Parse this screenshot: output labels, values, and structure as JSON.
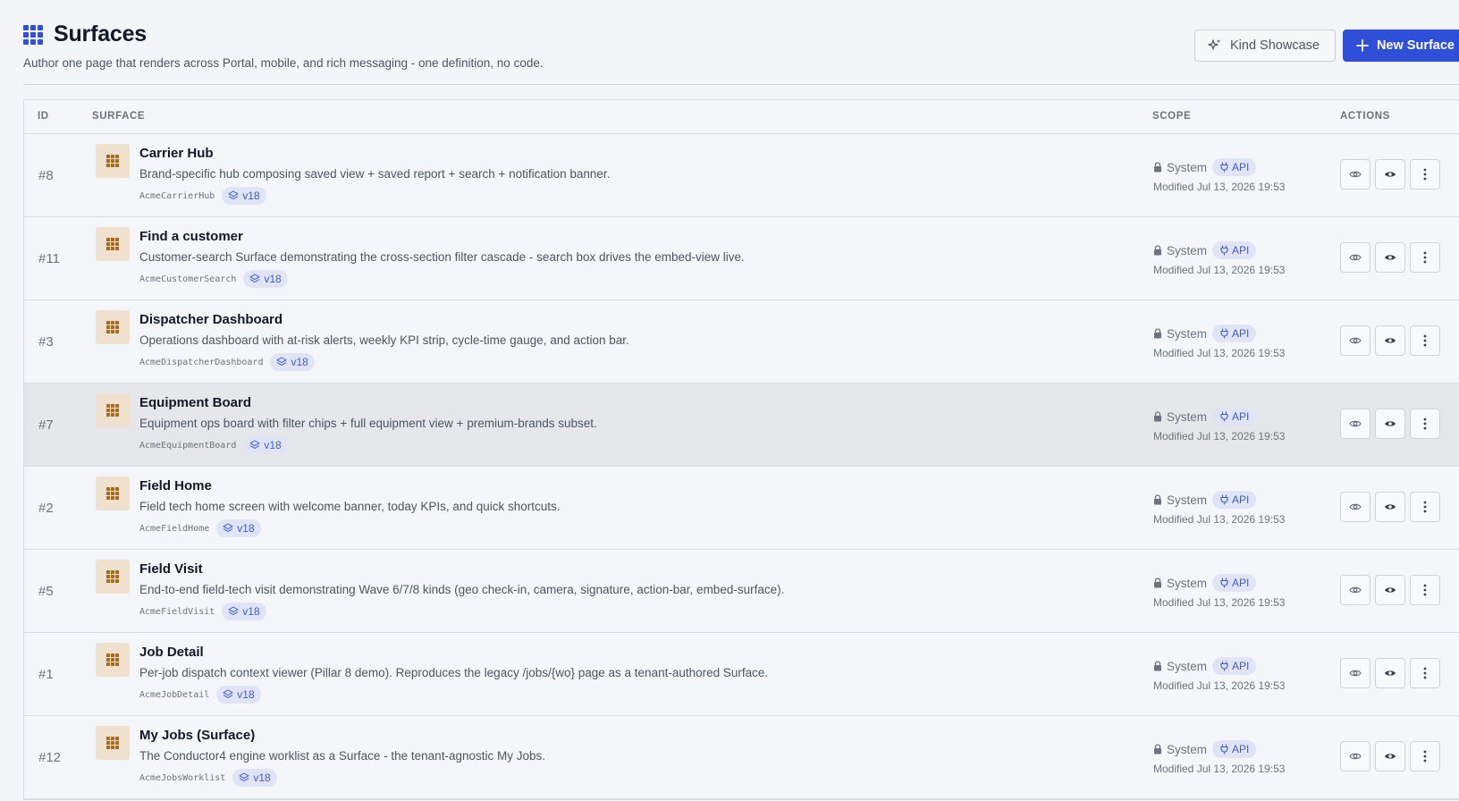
{
  "header": {
    "title": "Surfaces",
    "subtitle": "Author one page that renders across Portal, mobile, and rich messaging - one definition, no code.",
    "kind_showcase_label": "Kind Showcase",
    "new_surface_label": "New Surface"
  },
  "colors": {
    "primary": "#2f4fd8",
    "thumb_bg": "#f0e1cf",
    "thumb_icon": "#a86a1f",
    "badge_bg": "#dfe4f7",
    "badge_text": "#3f5bd3"
  },
  "table": {
    "columns": {
      "id": "ID",
      "surface": "SURFACE",
      "scope": "SCOPE",
      "actions": "ACTIONS"
    },
    "rows": [
      {
        "id": "#8",
        "name": "Carrier Hub",
        "description": "Brand-specific hub composing saved view + saved report + search + notification banner.",
        "code": "AcmeCarrierHub",
        "version": "v18",
        "scope": "System",
        "badge": "API",
        "modified": "Modified Jul 13, 2026 19:53"
      },
      {
        "id": "#11",
        "name": "Find a customer",
        "description": "Customer-search Surface demonstrating the cross-section filter cascade - search box drives the embed-view live.",
        "code": "AcmeCustomerSearch",
        "version": "v18",
        "scope": "System",
        "badge": "API",
        "modified": "Modified Jul 13, 2026 19:53"
      },
      {
        "id": "#3",
        "name": "Dispatcher Dashboard",
        "description": "Operations dashboard with at-risk alerts, weekly KPI strip, cycle-time gauge, and action bar.",
        "code": "AcmeDispatcherDashboard",
        "version": "v18",
        "scope": "System",
        "badge": "API",
        "modified": "Modified Jul 13, 2026 19:53"
      },
      {
        "id": "#7",
        "name": "Equipment Board",
        "description": "Equipment ops board with filter chips + full equipment view + premium-brands subset.",
        "code": "AcmeEquipmentBoard",
        "version": "v18",
        "scope": "System",
        "badge": "API",
        "modified": "Modified Jul 13, 2026 19:53"
      },
      {
        "id": "#2",
        "name": "Field Home",
        "description": "Field tech home screen with welcome banner, today KPIs, and quick shortcuts.",
        "code": "AcmeFieldHome",
        "version": "v18",
        "scope": "System",
        "badge": "API",
        "modified": "Modified Jul 13, 2026 19:53"
      },
      {
        "id": "#5",
        "name": "Field Visit",
        "description": "End-to-end field-tech visit demonstrating Wave 6/7/8 kinds (geo check-in, camera, signature, action-bar, embed-surface).",
        "code": "AcmeFieldVisit",
        "version": "v18",
        "scope": "System",
        "badge": "API",
        "modified": "Modified Jul 13, 2026 19:53"
      },
      {
        "id": "#1",
        "name": "Job Detail",
        "description": "Per-job dispatch context viewer (Pillar 8 demo). Reproduces the legacy /jobs/{wo} page as a tenant-authored Surface.",
        "code": "AcmeJobDetail",
        "version": "v18",
        "scope": "System",
        "badge": "API",
        "modified": "Modified Jul 13, 2026 19:53"
      },
      {
        "id": "#12",
        "name": "My Jobs (Surface)",
        "description": "The Conductor4 engine worklist as a Surface - the tenant-agnostic My Jobs.",
        "code": "AcmeJobsWorklist",
        "version": "v18",
        "scope": "System",
        "badge": "API",
        "modified": "Modified Jul 13, 2026 19:53"
      }
    ]
  }
}
